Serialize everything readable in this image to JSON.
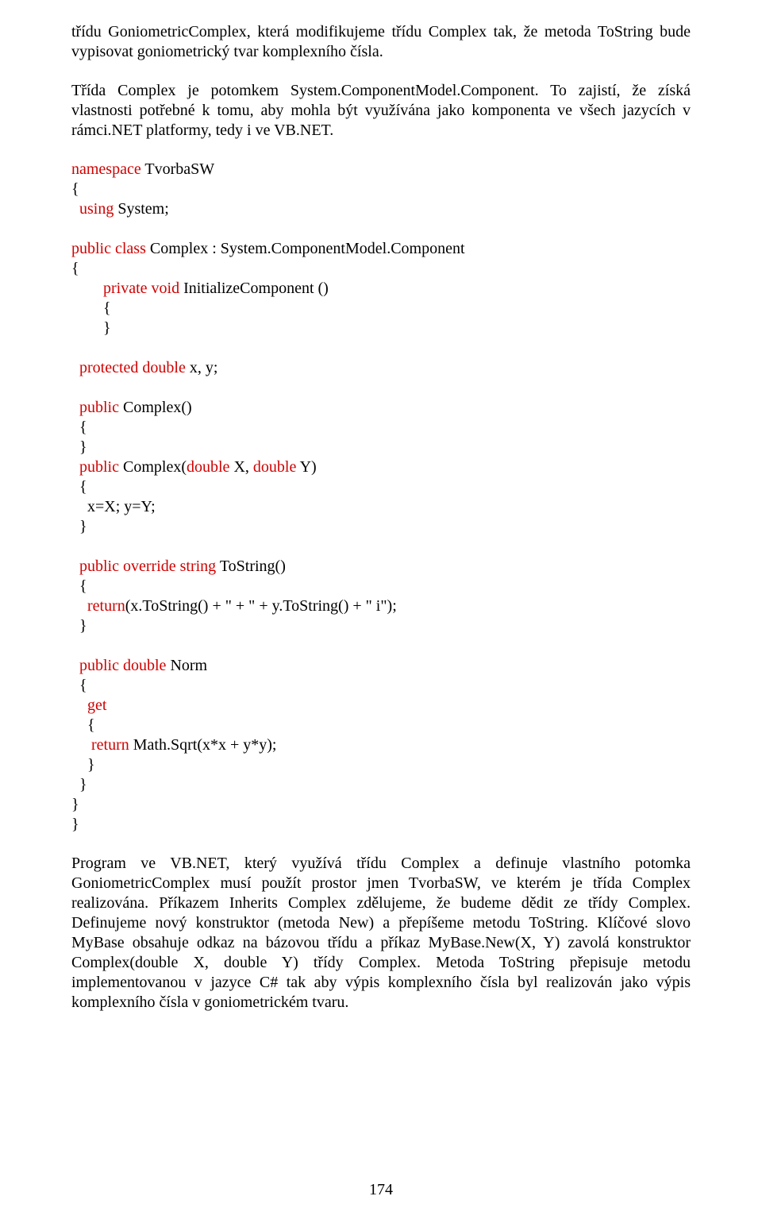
{
  "para1": "třídu GoniometricComplex, která modifikujeme třídu Complex tak, že metoda ToString bude vypisovat goniometrický tvar komplexního čísla.",
  "para2": "Třída Complex je potomkem System.ComponentModel.Component. To zajistí, že získá vlastnosti potřebné k tomu, aby mohla být využívána jako komponenta ve všech jazycích v rámci.NET platformy, tedy i ve VB.NET.",
  "code": {
    "l01a": "namespace",
    "l01b": " TvorbaSW",
    "l02": "{",
    "l03a": "  using",
    "l03b": " System;",
    "l04a": "public class",
    "l04b": " Complex : System.ComponentModel.Component",
    "l05": "{",
    "l06a": "        private void",
    "l06b": " InitializeComponent ()",
    "l07": "        {",
    "l08": "        }",
    "l09a": "  protected double",
    "l09b": " x, y;",
    "l10a": "  public",
    "l10b": " Complex()",
    "l11": "  {",
    "l12": "  }",
    "l13a": "  public",
    "l13b": " Complex(",
    "l13c": "double",
    "l13d": " X, ",
    "l13e": "double",
    "l13f": " Y)",
    "l14": "  {",
    "l15": "    x=X; y=Y;",
    "l16": "  }",
    "l17a": "  public override string",
    "l17b": " ToString()",
    "l18": "  {",
    "l19a": "    return",
    "l19b": "(x.ToString() + \" + \" + y.ToString() + \" i\");",
    "l20": "  }",
    "l21a": "  public double",
    "l21b": " Norm",
    "l22": "  {",
    "l23": "    get",
    "l24": "    {",
    "l25a": "     return",
    "l25b": " Math.Sqrt(x*x + y*y);",
    "l26": "    }",
    "l27": "  }",
    "l28": "}",
    "l29": "}"
  },
  "para3": "Program ve VB.NET, který využívá třídu Complex a definuje vlastního potomka GoniometricComplex musí použít prostor jmen TvorbaSW, ve kterém je třída Complex realizována. Příkazem  Inherits Complex zdělujeme, že budeme dědit ze třídy Complex. Definujeme nový konstruktor (metoda New) a přepíšeme metodu ToString. Klíčové slovo MyBase obsahuje odkaz na bázovou třídu a příkaz MyBase.New(X, Y) zavolá konstruktor Complex(double X, double Y) třídy Complex. Metoda ToString přepisuje metodu implementovanou v jazyce C# tak aby výpis komplexního čísla byl realizován jako výpis komplexního čísla v goniometrickém tvaru.",
  "pagenumber": "174"
}
